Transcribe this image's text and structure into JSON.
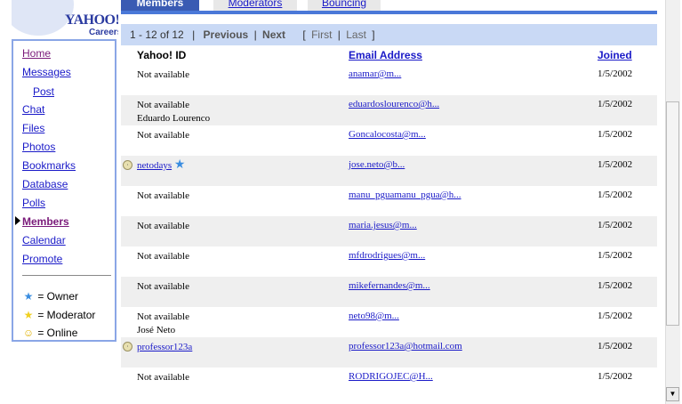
{
  "logo": {
    "brand": "YAHOO!",
    "sub": "Careers"
  },
  "nav": {
    "items": [
      {
        "label": "Home"
      },
      {
        "label": "Messages"
      },
      {
        "label": "Post"
      },
      {
        "label": "Chat"
      },
      {
        "label": "Files"
      },
      {
        "label": "Photos"
      },
      {
        "label": "Bookmarks"
      },
      {
        "label": "Database"
      },
      {
        "label": "Polls"
      },
      {
        "label": "Members"
      },
      {
        "label": "Calendar"
      },
      {
        "label": "Promote"
      }
    ],
    "legend": [
      {
        "symbol": "★",
        "label": "= Owner",
        "color": "#3a8de0"
      },
      {
        "symbol": "★",
        "label": "= Moderator",
        "color": "#f0d020"
      },
      {
        "symbol": "☺",
        "label": "= Online",
        "color": "#e0b000"
      }
    ]
  },
  "tabs": {
    "members": "Members",
    "moderators": "Moderators",
    "bouncing": "Bouncing"
  },
  "pager": {
    "range": "1 - 12 of 12",
    "sep1": "|",
    "previous": "Previous",
    "sep2": "|",
    "next": "Next",
    "open_bracket": "[",
    "first": "First",
    "sep3": "|",
    "last": "Last",
    "close_bracket": "]"
  },
  "table": {
    "headers": {
      "yahoo_id": "Yahoo! ID",
      "email": "Email Address",
      "joined": "Joined"
    },
    "rows": [
      {
        "id": "Not available",
        "name": "",
        "email": "anamar@m...",
        "joined": "1/5/2002"
      },
      {
        "id": "Not available",
        "name": "Eduardo Lourenco",
        "email": "eduardoslourenco@h...",
        "joined": "1/5/2002"
      },
      {
        "id": "Not available",
        "name": "",
        "email": "Goncalocosta@m...",
        "joined": "1/5/2002"
      },
      {
        "id": "netodays",
        "name": "",
        "email": "jose.neto@b...",
        "joined": "1/5/2002"
      },
      {
        "id": "Not available",
        "name": "",
        "email": "manu_pguamanu_pgua@h...",
        "joined": "1/5/2002"
      },
      {
        "id": "Not available",
        "name": "",
        "email": "maria.jesus@m...",
        "joined": "1/5/2002"
      },
      {
        "id": "Not available",
        "name": "",
        "email": "mfdrodrigues@m...",
        "joined": "1/5/2002"
      },
      {
        "id": "Not available",
        "name": "",
        "email": "mikefernandes@m...",
        "joined": "1/5/2002"
      },
      {
        "id": "Not available",
        "name": "José Neto",
        "email": "neto98@m...",
        "joined": "1/5/2002"
      },
      {
        "id": "professor123a",
        "name": "",
        "email": "professor123a@hotmail.com",
        "joined": "1/5/2002"
      },
      {
        "id": "Not available",
        "name": "",
        "email": "RODRIGOJEC@H...",
        "joined": "1/5/2002"
      }
    ]
  },
  "scrollbar": {
    "down_glyph": "▼"
  }
}
